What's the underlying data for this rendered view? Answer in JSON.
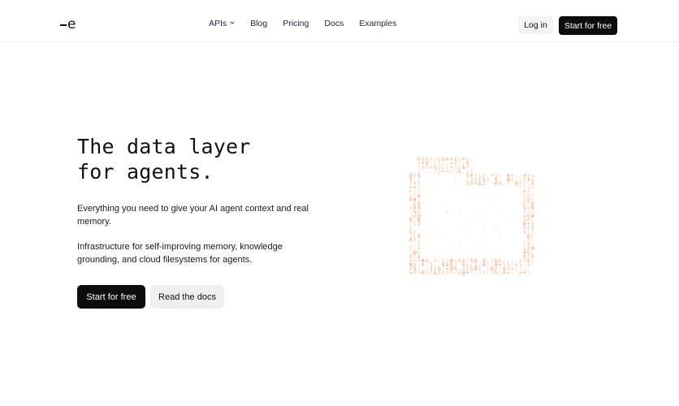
{
  "brand": {
    "logo_letter": "e",
    "logo_icon": "dash-e-logo-icon"
  },
  "nav": {
    "items": [
      {
        "label": "APIs",
        "has_dropdown": true
      },
      {
        "label": "Blog"
      },
      {
        "label": "Pricing"
      },
      {
        "label": "Docs"
      },
      {
        "label": "Examples"
      }
    ],
    "dropdown_icon": "chevron-down-icon"
  },
  "header_actions": {
    "login_label": "Log in",
    "start_label": "Start for free"
  },
  "hero": {
    "title_line1": "The data layer",
    "title_line2": "for agents.",
    "description1": "Everything you need to give your AI agent context and real memory.",
    "description2": "Infrastructure for self-improving memory, knowledge grounding, and cloud filesystems for agents.",
    "primary_cta": "Start for free",
    "secondary_cta": "Read the docs"
  },
  "illustration": {
    "icon": "ascii-folder-icon",
    "accent_color": "#f08a4b",
    "light_color": "#f7c3a0"
  },
  "colors": {
    "background": "#ffffff",
    "primary_button": "#0c0c0c",
    "secondary_button": "#efefef",
    "nav_text": "#24244a"
  }
}
